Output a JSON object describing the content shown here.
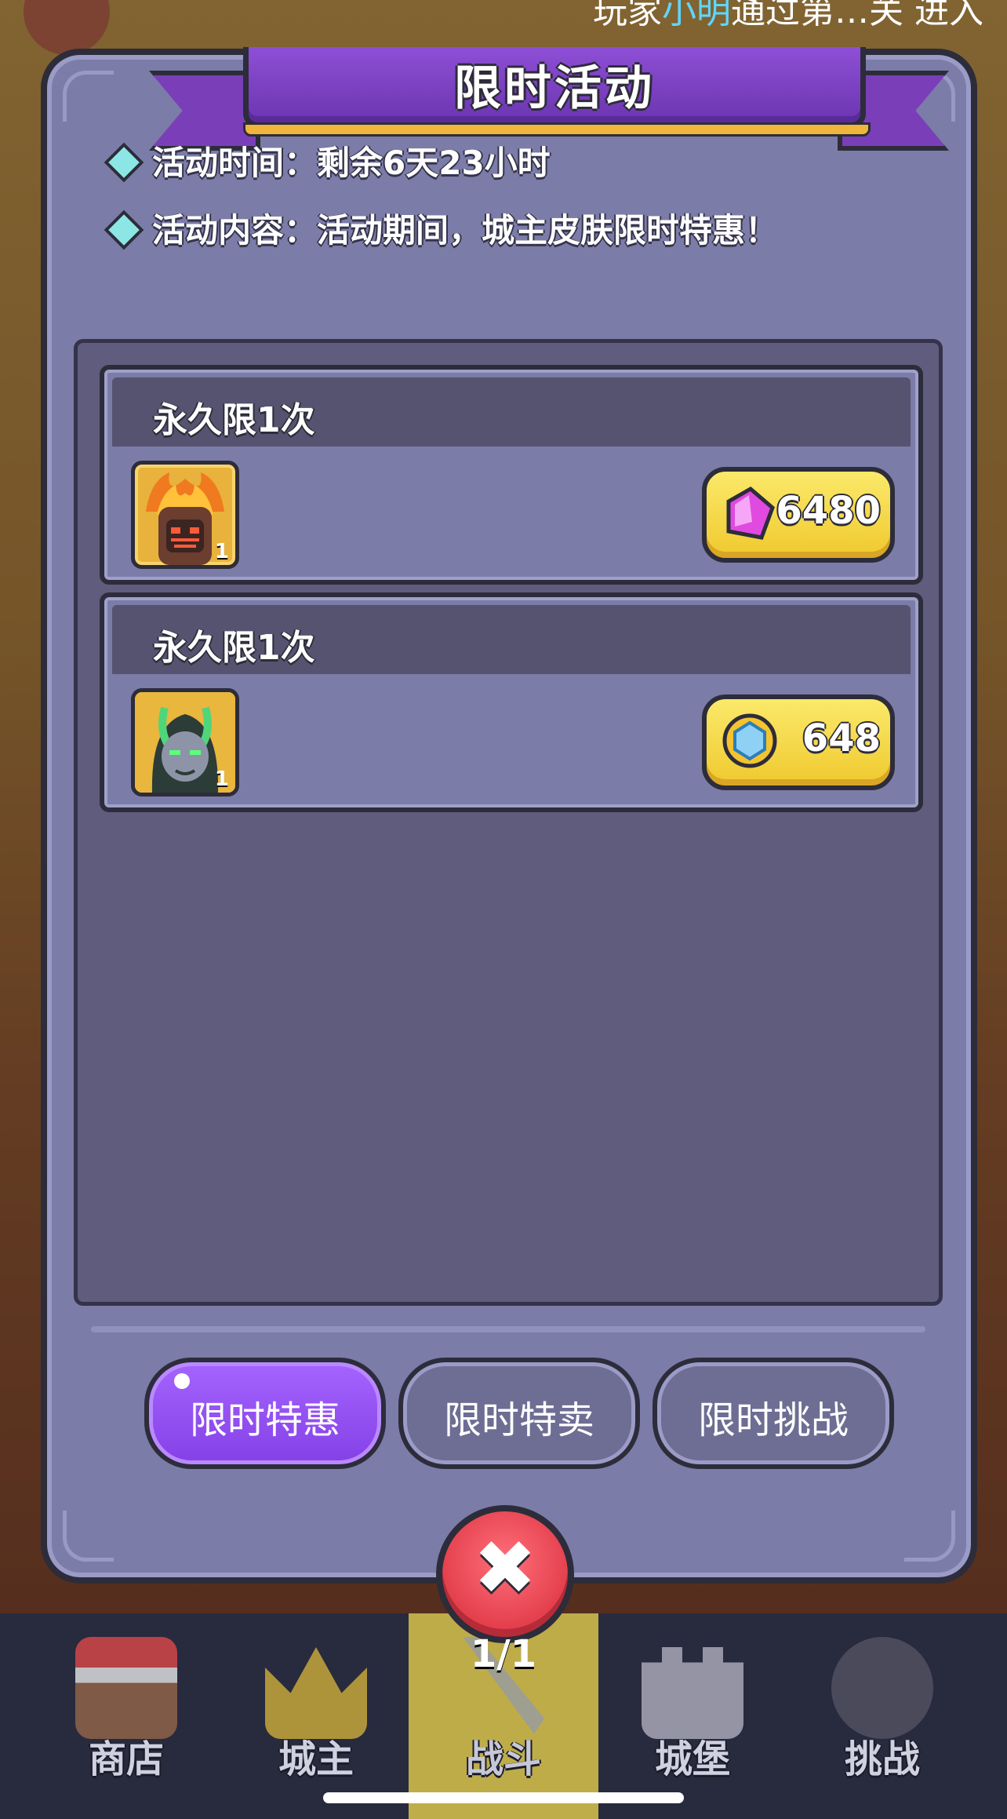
{
  "header": {
    "marquee_prefix": "玩家",
    "marquee_highlight": "小明",
    "marquee_suffix": "通过第…关 进入"
  },
  "modal": {
    "title": "限时活动",
    "info": [
      {
        "text": "活动时间：剩余6天23小时"
      },
      {
        "text": "活动内容：活动期间，城主皮肤限时特惠！"
      }
    ],
    "offers": [
      {
        "limit_label": "永久限1次",
        "item_qty": "1",
        "price": "6480",
        "currency_icon": "gem-icon"
      },
      {
        "limit_label": "永久限1次",
        "item_qty": "1",
        "price": "648",
        "currency_icon": "coin-icon"
      }
    ],
    "tabs": [
      {
        "label": "限时特惠",
        "active": true
      },
      {
        "label": "限时特卖",
        "active": false
      },
      {
        "label": "限时挑战",
        "active": false
      }
    ],
    "close_icon": "close-icon"
  },
  "page_indicator": "1/1",
  "bottom_nav": [
    {
      "label": "商店",
      "icon": "shop-icon",
      "active": false
    },
    {
      "label": "城主",
      "icon": "crown-icon",
      "active": false
    },
    {
      "label": "战斗",
      "icon": "swords-icon",
      "active": true
    },
    {
      "label": "城堡",
      "icon": "castle-icon",
      "active": false
    },
    {
      "label": "挑战",
      "icon": "challenge-icon",
      "active": false
    }
  ],
  "colors": {
    "accent_purple": "#8a48ea",
    "modal_bg": "#7b7ca8",
    "price_yellow": "#f5d94a",
    "close_red": "#e84a56"
  }
}
